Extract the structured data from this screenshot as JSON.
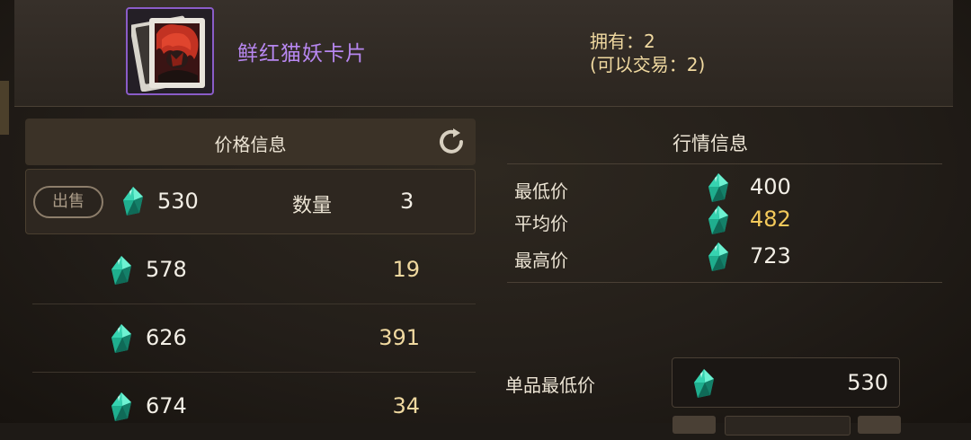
{
  "item": {
    "name": "鲜红猫妖卡片",
    "owned_text": "拥有：2",
    "tradeable_text": "(可以交易：2)"
  },
  "price_info": {
    "title": "价格信息",
    "my_listing": {
      "action_label": "出售",
      "price": "530",
      "qty_label": "数量",
      "qty": "3"
    },
    "rows": [
      {
        "price": "578",
        "qty": "19"
      },
      {
        "price": "626",
        "qty": "391"
      },
      {
        "price": "674",
        "qty": "34"
      }
    ]
  },
  "market_info": {
    "title": "行情信息",
    "lowest_label": "最低价",
    "lowest_value": "400",
    "average_label": "平均价",
    "average_value": "482",
    "highest_label": "最高价",
    "highest_value": "723"
  },
  "sell_form": {
    "unit_min_label": "单品最低价",
    "unit_price_value": "530"
  },
  "colors": {
    "item_name": "#b787f0",
    "gem": "#2ec9a8",
    "average_value": "#f3c95a",
    "frame": "#8a5cc8"
  },
  "icons": [
    "card-icon",
    "gem-icon",
    "refresh-icon"
  ]
}
